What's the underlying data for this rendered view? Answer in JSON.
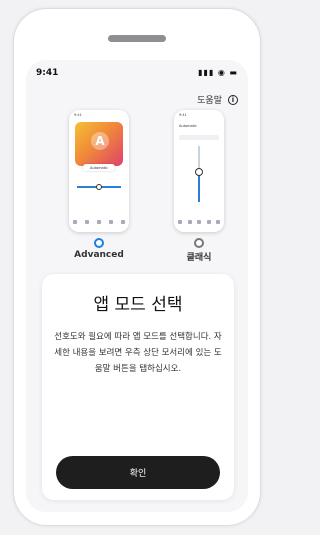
{
  "status_bar": {
    "time": "9:41",
    "icons": "▮▮▮ ◉ ▬"
  },
  "help": {
    "label": "도움말",
    "icon": "info-icon",
    "icon_glyph": "i"
  },
  "preview_advanced": {
    "time": "9:41",
    "letter": "A",
    "chip": "Automatic"
  },
  "preview_classic": {
    "time": "9:41",
    "chip": "Automatic"
  },
  "modes": {
    "advanced": {
      "label": "Advanced",
      "selected": true
    },
    "classic": {
      "label": "클래식",
      "selected": false
    }
  },
  "card": {
    "title": "앱 모드 선택",
    "description": "선호도와 필요에 따라 앱 모드를 선택합니다. 자세한 내용을 보려면 우측 상단 모서리에 있는 도움말 버튼을 탭하십시오.",
    "confirm_label": "확인"
  },
  "colors": {
    "accent": "#1d7fe0",
    "button": "#1e1e1f"
  }
}
